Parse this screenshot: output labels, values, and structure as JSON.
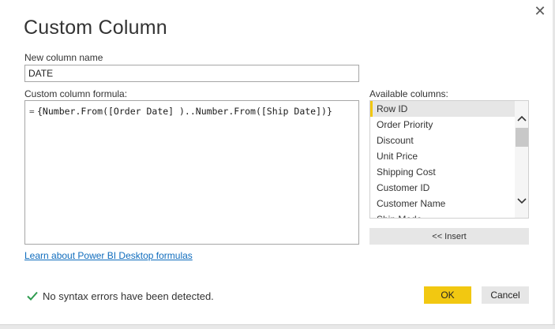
{
  "dialog": {
    "title": "Custom Column",
    "close_glyph": "✕",
    "name_label": "New column name",
    "name_value": "DATE",
    "formula_label": "Custom column formula:",
    "formula_eq": "=",
    "formula_text": "{Number.From([Order Date] )..Number.From([Ship Date])}",
    "available_label": "Available columns:",
    "columns": [
      "Row ID",
      "Order Priority",
      "Discount",
      "Unit Price",
      "Shipping Cost",
      "Customer ID",
      "Customer Name",
      "Ship Mode"
    ],
    "selected_column": "Row ID",
    "insert_label": "<< Insert",
    "learn_link": "Learn about Power BI Desktop formulas",
    "status_text": "No syntax errors have been detected.",
    "ok_label": "OK",
    "cancel_label": "Cancel"
  },
  "icons": {
    "close": "close-icon",
    "check": "checkmark-icon",
    "scroll_up": "chevron-up-icon",
    "scroll_down": "chevron-down-icon"
  },
  "colors": {
    "accent": "#f2c811",
    "link": "#0f6cbd",
    "success": "#2e9b4f"
  }
}
